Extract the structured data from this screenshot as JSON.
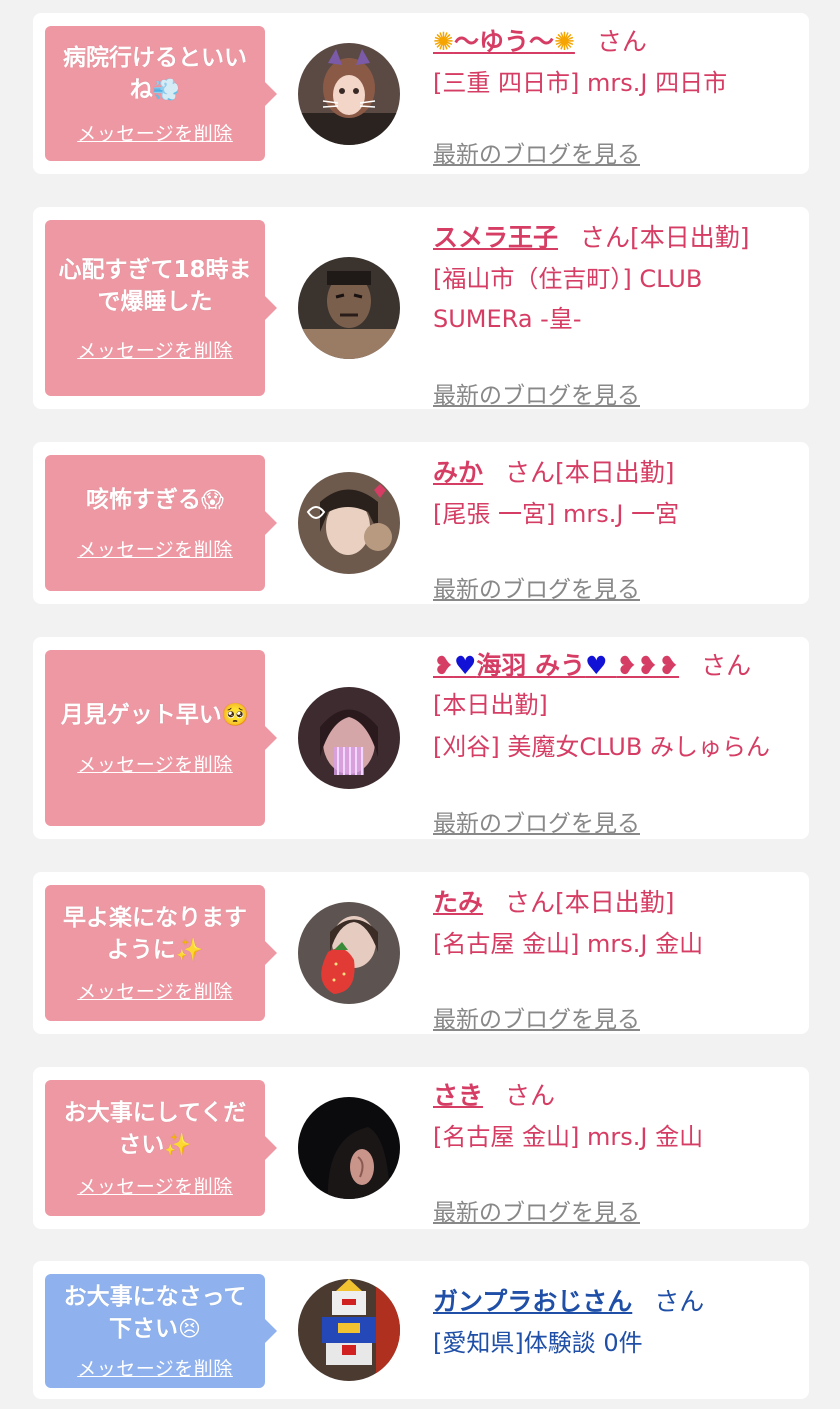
{
  "delete_label": "メッセージを削除",
  "blog_label": "最新のブログを見る",
  "colors": {
    "pink_bubble": "#ee98a3",
    "blue_bubble": "#8fb2ee",
    "pink_text": "#d63d64",
    "blue_text": "#1f4fa6"
  },
  "items": [
    {
      "message": "病院行けるといいね",
      "message_icon": "wind-face-icon",
      "name": "〜ゆう〜",
      "name_prefix_icon": "sun-icon",
      "name_suffix_icon": "sun-icon",
      "suffix": "さん",
      "shop": "[三重 四日市] mrs.J 四日市",
      "show_blog": true
    },
    {
      "message": "心配すぎて18時まで爆睡した",
      "name": "スメラ王子",
      "suffix": "さん[本日出勤]",
      "shop": "[福山市（住吉町）] CLUB SUMERa -皇-",
      "show_blog": true
    },
    {
      "message": "咳怖すぎる",
      "message_icon": "scream-face-icon",
      "name": "みか",
      "suffix": "さん[本日出勤]",
      "shop": "[尾張 一宮] mrs.J 一宮",
      "show_blog": true
    },
    {
      "message": "月見ゲット早い",
      "message_icon": "pleading-face-icon",
      "name": "海羽 みう",
      "name_decor_icon": "heart-icon",
      "suffix": "さん",
      "status": "[本日出勤]",
      "shop": "[刈谷] 美魔女CLUB みしゅらん",
      "show_blog": true
    },
    {
      "message": "早よ楽になりますように",
      "message_icon": "sparkles-icon",
      "name": "たみ",
      "suffix": "さん[本日出勤]",
      "shop": "[名古屋 金山] mrs.J 金山",
      "show_blog": true
    },
    {
      "message": "お大事にしてください",
      "message_icon": "sparkles-icon",
      "name": "さき",
      "suffix": "さん",
      "shop": "[名古屋 金山] mrs.J 金山",
      "show_blog": true
    },
    {
      "message": "お大事になさって下さい",
      "message_icon": "persevering-face-icon",
      "name": "ガンプラおじさん",
      "suffix": "さん",
      "shop": "[愛知県]体験談 0件",
      "show_blog": false
    }
  ]
}
